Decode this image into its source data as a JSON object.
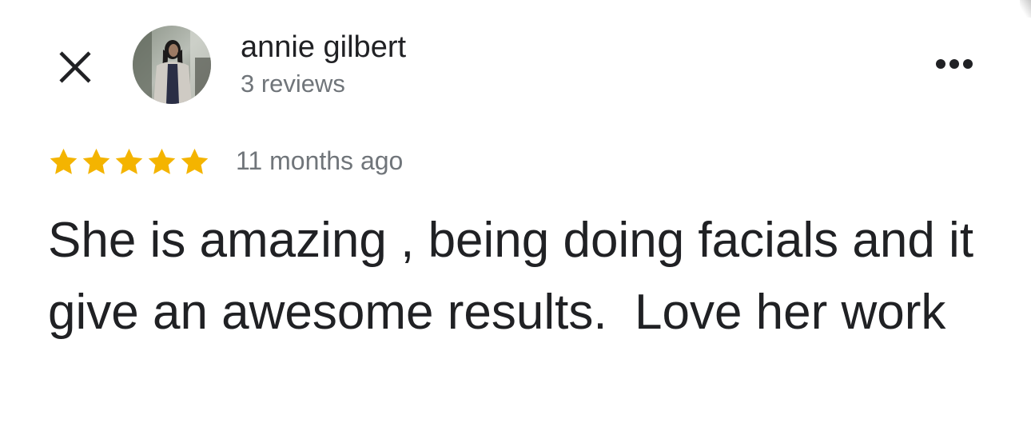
{
  "reviewer": {
    "name": "annie gilbert",
    "review_count": "3 reviews",
    "avatar_icon": "profile-photo"
  },
  "header": {
    "close_icon": "close-icon",
    "more_icon": "more-options-icon"
  },
  "review": {
    "rating": 5,
    "rating_max": 5,
    "date": "11 months ago",
    "text": "She is amazing , being doing facials and it give an awesome results.  Love her work"
  },
  "colors": {
    "star": "#f4b400",
    "primary_text": "#202124",
    "secondary_text": "#70757a"
  }
}
